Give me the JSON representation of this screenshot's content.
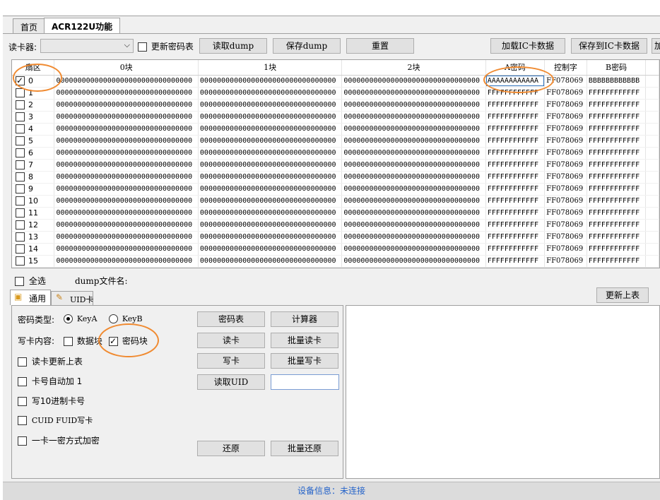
{
  "tabs": [
    {
      "label": "首页"
    },
    {
      "label": "ACR122U功能"
    }
  ],
  "toolbar": {
    "reader_label": "读卡器:",
    "reader_value": "",
    "update_key_table": "更新密码表",
    "read_dump": "读取dump",
    "save_dump": "保存dump",
    "reset": "重置",
    "load_ic": "加载IC卡数据",
    "save_ic": "保存到IC卡数据",
    "more": "加"
  },
  "grid": {
    "columns": [
      "扇区",
      "0块",
      "1块",
      "2块",
      "A密码",
      "控制字",
      "B密码"
    ],
    "rows": [
      {
        "sector": "0",
        "checked": true,
        "b0": "00000000000000000000000000000000",
        "b1": "00000000000000000000000000000000",
        "b2": "00000000000000000000000000000000",
        "a": "AAAAAAAAAAAA",
        "ctrl": "FF078069",
        "b": "BBBBBBBBBBBB"
      },
      {
        "sector": "1",
        "checked": false,
        "b0": "00000000000000000000000000000000",
        "b1": "00000000000000000000000000000000",
        "b2": "00000000000000000000000000000000",
        "a": "FFFFFFFFFFFF",
        "ctrl": "FF078069",
        "b": "FFFFFFFFFFFF"
      },
      {
        "sector": "2",
        "checked": false,
        "b0": "00000000000000000000000000000000",
        "b1": "00000000000000000000000000000000",
        "b2": "00000000000000000000000000000000",
        "a": "FFFFFFFFFFFF",
        "ctrl": "FF078069",
        "b": "FFFFFFFFFFFF"
      },
      {
        "sector": "3",
        "checked": false,
        "b0": "00000000000000000000000000000000",
        "b1": "00000000000000000000000000000000",
        "b2": "00000000000000000000000000000000",
        "a": "FFFFFFFFFFFF",
        "ctrl": "FF078069",
        "b": "FFFFFFFFFFFF"
      },
      {
        "sector": "4",
        "checked": false,
        "b0": "00000000000000000000000000000000",
        "b1": "00000000000000000000000000000000",
        "b2": "00000000000000000000000000000000",
        "a": "FFFFFFFFFFFF",
        "ctrl": "FF078069",
        "b": "FFFFFFFFFFFF"
      },
      {
        "sector": "5",
        "checked": false,
        "b0": "00000000000000000000000000000000",
        "b1": "00000000000000000000000000000000",
        "b2": "00000000000000000000000000000000",
        "a": "FFFFFFFFFFFF",
        "ctrl": "FF078069",
        "b": "FFFFFFFFFFFF"
      },
      {
        "sector": "6",
        "checked": false,
        "b0": "00000000000000000000000000000000",
        "b1": "00000000000000000000000000000000",
        "b2": "00000000000000000000000000000000",
        "a": "FFFFFFFFFFFF",
        "ctrl": "FF078069",
        "b": "FFFFFFFFFFFF"
      },
      {
        "sector": "7",
        "checked": false,
        "b0": "00000000000000000000000000000000",
        "b1": "00000000000000000000000000000000",
        "b2": "00000000000000000000000000000000",
        "a": "FFFFFFFFFFFF",
        "ctrl": "FF078069",
        "b": "FFFFFFFFFFFF"
      },
      {
        "sector": "8",
        "checked": false,
        "b0": "00000000000000000000000000000000",
        "b1": "00000000000000000000000000000000",
        "b2": "00000000000000000000000000000000",
        "a": "FFFFFFFFFFFF",
        "ctrl": "FF078069",
        "b": "FFFFFFFFFFFF"
      },
      {
        "sector": "9",
        "checked": false,
        "b0": "00000000000000000000000000000000",
        "b1": "00000000000000000000000000000000",
        "b2": "00000000000000000000000000000000",
        "a": "FFFFFFFFFFFF",
        "ctrl": "FF078069",
        "b": "FFFFFFFFFFFF"
      },
      {
        "sector": "10",
        "checked": false,
        "b0": "00000000000000000000000000000000",
        "b1": "00000000000000000000000000000000",
        "b2": "00000000000000000000000000000000",
        "a": "FFFFFFFFFFFF",
        "ctrl": "FF078069",
        "b": "FFFFFFFFFFFF"
      },
      {
        "sector": "11",
        "checked": false,
        "b0": "00000000000000000000000000000000",
        "b1": "00000000000000000000000000000000",
        "b2": "00000000000000000000000000000000",
        "a": "FFFFFFFFFFFF",
        "ctrl": "FF078069",
        "b": "FFFFFFFFFFFF"
      },
      {
        "sector": "12",
        "checked": false,
        "b0": "00000000000000000000000000000000",
        "b1": "00000000000000000000000000000000",
        "b2": "00000000000000000000000000000000",
        "a": "FFFFFFFFFFFF",
        "ctrl": "FF078069",
        "b": "FFFFFFFFFFFF"
      },
      {
        "sector": "13",
        "checked": false,
        "b0": "00000000000000000000000000000000",
        "b1": "00000000000000000000000000000000",
        "b2": "00000000000000000000000000000000",
        "a": "FFFFFFFFFFFF",
        "ctrl": "FF078069",
        "b": "FFFFFFFFFFFF"
      },
      {
        "sector": "14",
        "checked": false,
        "b0": "00000000000000000000000000000000",
        "b1": "00000000000000000000000000000000",
        "b2": "00000000000000000000000000000000",
        "a": "FFFFFFFFFFFF",
        "ctrl": "FF078069",
        "b": "FFFFFFFFFFFF"
      },
      {
        "sector": "15",
        "checked": false,
        "b0": "00000000000000000000000000000000",
        "b1": "00000000000000000000000000000000",
        "b2": "00000000000000000000000000000000",
        "a": "FFFFFFFFFFFF",
        "ctrl": "FF078069",
        "b": "FFFFFFFFFFFF"
      }
    ]
  },
  "below_grid": {
    "select_all": "全选",
    "dump_filename_label": "dump文件名:",
    "update_table_button": "更新上表"
  },
  "subtabs": [
    {
      "label": "通用",
      "icon": "box-icon"
    },
    {
      "label": "UID卡",
      "icon": "edit-icon"
    }
  ],
  "general": {
    "key_type_label": "密码类型:",
    "key_a": "KeyA",
    "key_b": "KeyB",
    "key_type_selected": "KeyA",
    "write_content_label": "写卡内容:",
    "data_block": "数据块",
    "data_block_checked": false,
    "key_block": "密码块",
    "key_block_checked": true,
    "options": [
      {
        "label": "读卡更新上表",
        "checked": false
      },
      {
        "label": "卡号自动加 1",
        "checked": false
      },
      {
        "label": "写10进制卡号",
        "checked": false
      },
      {
        "label": "CUID FUID写卡",
        "checked": false
      },
      {
        "label": "一卡一密方式加密",
        "checked": false
      }
    ],
    "buttons": {
      "key_table": "密码表",
      "calculator": "计算器",
      "read_card": "读卡",
      "batch_read": "批量读卡",
      "write_card": "写卡",
      "batch_write": "批量写卡",
      "read_uid": "读取UID",
      "restore": "还原",
      "batch_restore": "批量还原"
    },
    "uid_value": ""
  },
  "status": {
    "text": "设备信息：未连接"
  },
  "colors": {
    "highlight": "#f08a30",
    "status_text": "#2563c9"
  }
}
